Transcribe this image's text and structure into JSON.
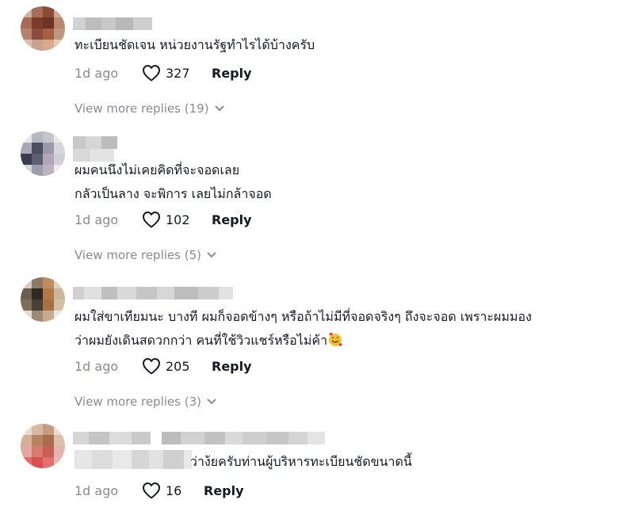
{
  "colors": {
    "text": "#161823",
    "muted": "#8a8b91",
    "background": "#ffffff"
  },
  "comments": [
    {
      "text_lines": [
        "ทะเบียนชัดเจน หน่วยงานรัฐทำไรได้บ้างครับ"
      ],
      "time": "1d ago",
      "likes": "327",
      "reply_label": "Reply",
      "view_more": "View more replies (19)"
    },
    {
      "text_lines": [
        "ผมคนนึงไม่เคยคิดที่จะจอดเลย",
        "กลัวเป็นลาง จะพิการ เลยไม่กล้าจอด"
      ],
      "time": "1d ago",
      "likes": "102",
      "reply_label": "Reply",
      "view_more": "View more replies (5)"
    },
    {
      "text_lines": [
        "ผมใส่ขาเทียมนะ บางที ผมก็จอดข้างๆ หรือถ้าไม่มีที่จอดจริงๆ ถึงจะจอด เพราะผมมอง",
        "ว่าผมยังเดินสดวกกว่า คนที่ใช้วิวแชร์หรือไม่ค้า"
      ],
      "emoji": "smiling-face-with-hearts",
      "time": "1d ago",
      "likes": "205",
      "reply_label": "Reply",
      "view_more": "View more replies (3)"
    },
    {
      "text_lines": [
        "ว่าง้ยครับท่านผู้บริหารทะเบียนชัดขนาดนี้"
      ],
      "time": "1d ago",
      "likes": "16",
      "reply_label": "Reply"
    }
  ]
}
